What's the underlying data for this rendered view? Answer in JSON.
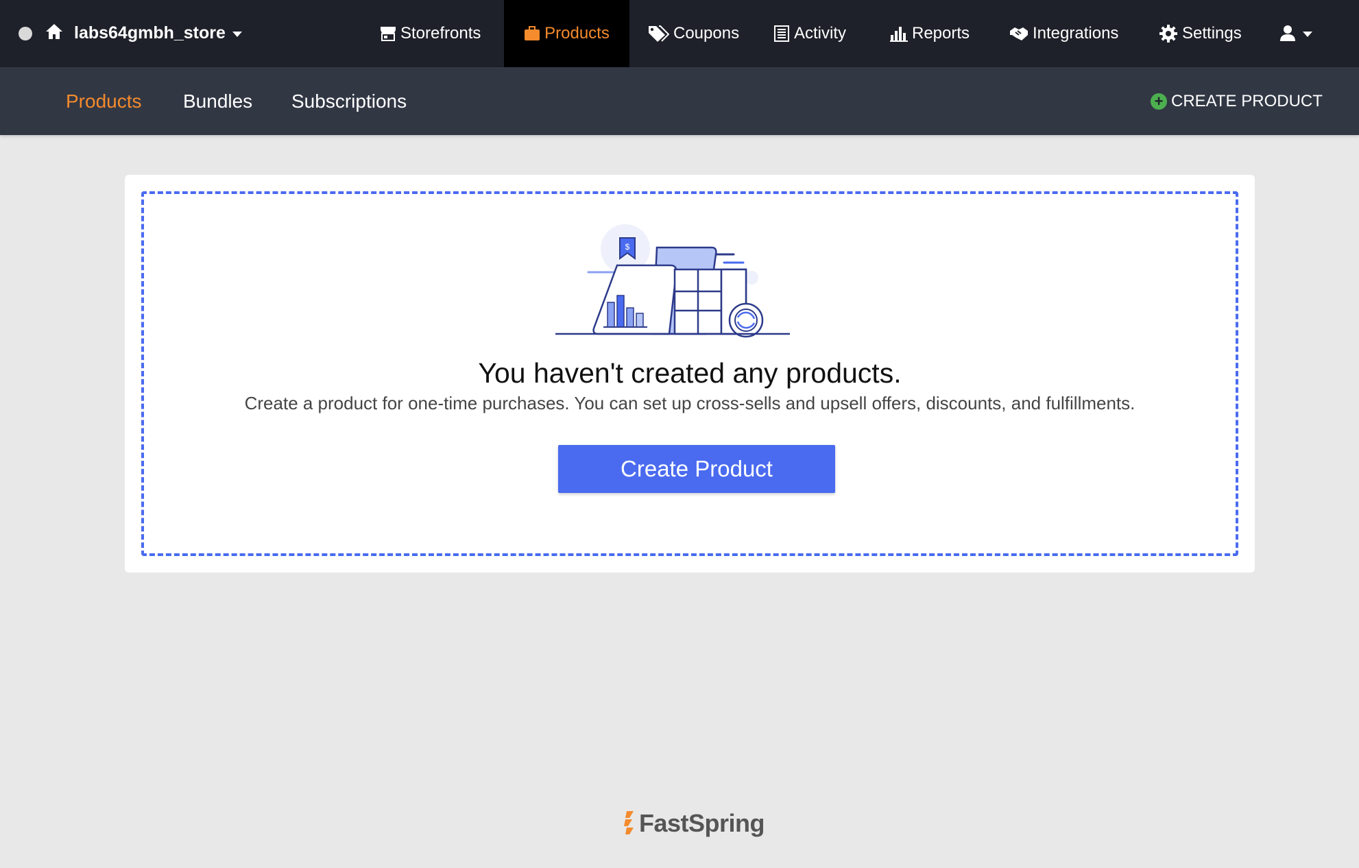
{
  "topnav": {
    "store_name": "labs64gmbh_store",
    "items": [
      {
        "label": "Storefronts",
        "icon": "storefront-icon"
      },
      {
        "label": "Products",
        "icon": "briefcase-icon",
        "active": true
      },
      {
        "label": "Coupons",
        "icon": "tags-icon"
      },
      {
        "label": "Activity",
        "icon": "list-icon"
      },
      {
        "label": "Reports",
        "icon": "bar-chart-icon"
      },
      {
        "label": "Integrations",
        "icon": "handshake-icon"
      },
      {
        "label": "Settings",
        "icon": "gear-icon"
      }
    ],
    "user_icon": "user-icon"
  },
  "subnav": {
    "tabs": [
      {
        "label": "Products",
        "active": true
      },
      {
        "label": "Bundles"
      },
      {
        "label": "Subscriptions"
      }
    ],
    "create_label": "CREATE PRODUCT"
  },
  "empty_state": {
    "title": "You haven't created any products.",
    "description": "Create a product for one-time purchases. You can set up cross-sells and upsell offers, discounts, and fulfillments.",
    "button_label": "Create Product",
    "illustration": "products-illustration"
  },
  "footer": {
    "brand": "FastSpring"
  },
  "colors": {
    "topnav_bg": "#1e2129",
    "subnav_bg": "#323744",
    "accent_orange": "#f48b2d",
    "primary_blue": "#4a6bf0",
    "page_bg": "#e8e8e8"
  }
}
